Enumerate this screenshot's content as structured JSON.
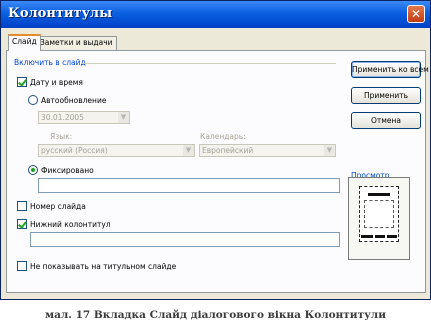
{
  "window": {
    "title": "Колонтитулы",
    "close_symbol": "✕"
  },
  "tabs": [
    {
      "label": "Слайд",
      "active": true
    },
    {
      "label": "Заметки и выдачи",
      "active": false
    }
  ],
  "include_group": {
    "title": "Включить в слайд",
    "date_time": {
      "label": "Дату и время",
      "checked": true
    },
    "auto_update": {
      "label": "Автообновление",
      "selected": false
    },
    "date_combo": {
      "value": "30.01.2005"
    },
    "language": {
      "label": "Язык:",
      "value": "русский (Россия)"
    },
    "calendar": {
      "label": "Календарь:",
      "value": "Европейский"
    },
    "fixed": {
      "label": "Фиксировано",
      "selected": true,
      "value": ""
    },
    "slide_number": {
      "label": "Номер слайда",
      "checked": false
    },
    "footer": {
      "label": "Нижний колонтитул",
      "checked": true,
      "value": ""
    }
  },
  "hide_on_title": {
    "label": "Не показывать на титульном слайде",
    "checked": false
  },
  "buttons": {
    "apply_all": "Применить ко всем",
    "apply": "Применить",
    "cancel": "Отмена"
  },
  "preview": {
    "title": "Просмотр"
  },
  "caption": "мал. 17 Вкладка Слайд діалогового вікна Колонтитули",
  "colors": {
    "titlebar": "#0a5fe0",
    "group_title": "#0046d5",
    "check": "#21a121"
  }
}
